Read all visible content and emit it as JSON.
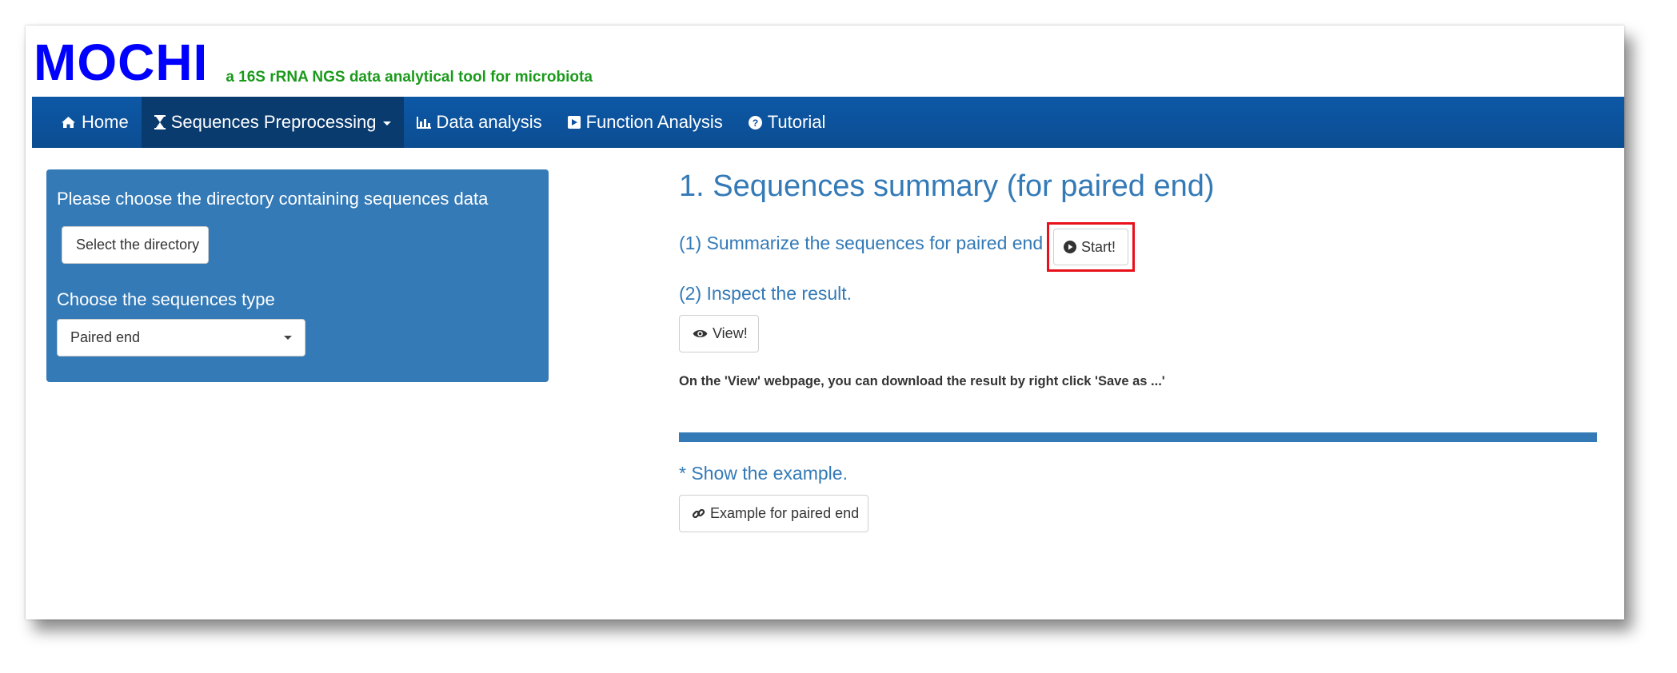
{
  "header": {
    "brand": "MOCHI",
    "subtitle": "a 16S rRNA NGS data analytical tool for microbiota"
  },
  "nav": {
    "items": [
      {
        "label": "Home",
        "icon": "home-icon"
      },
      {
        "label": "Sequences Preprocessing",
        "icon": "hourglass-icon",
        "dropdown": true,
        "active": true
      },
      {
        "label": "Data analysis",
        "icon": "bar-chart-icon"
      },
      {
        "label": "Function Analysis",
        "icon": "play-square-icon"
      },
      {
        "label": "Tutorial",
        "icon": "question-circle-icon"
      }
    ]
  },
  "sidebar": {
    "dir_label": "Please choose the directory containing sequences data",
    "dir_button": "Select the directory",
    "type_label": "Choose the sequences type",
    "type_selected": "Paired end"
  },
  "main": {
    "title": "1. Sequences summary (for paired end)",
    "step1": "(1) Summarize the sequences for paired end",
    "start_button": "Start!",
    "step2": "(2) Inspect the result.",
    "view_button": "View!",
    "note": "On the 'View' webpage, you can download the result by right click 'Save as ...'",
    "example_label": "* Show the example.",
    "example_button": "Example for paired end"
  },
  "colors": {
    "brand": "#0000ff",
    "subtitle": "#1a9a1a",
    "navbar": "#0d58a6",
    "panel": "#337ab7",
    "highlight": "#e8101a"
  }
}
